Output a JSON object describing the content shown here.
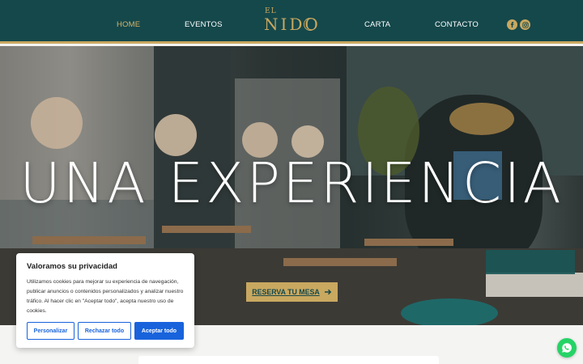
{
  "nav": {
    "items": [
      {
        "label": "HOME",
        "active": true
      },
      {
        "label": "EVENTOS",
        "active": false
      },
      {
        "label": "CARTA",
        "active": false
      },
      {
        "label": "CONTACTO",
        "active": false
      }
    ],
    "logo_top": "EL",
    "logo_main": "NIDO",
    "social": [
      "facebook-icon",
      "instagram-icon"
    ]
  },
  "hero": {
    "title": "UNA EXPERIENCIA",
    "cta_label": "RESERVA TU MESA"
  },
  "cookie": {
    "title": "Valoramos su privacidad",
    "text": "Utilizamos cookies para mejorar su experiencia de navegación, publicar anuncios o contenidos personalizados y analizar nuestro tráfico. Al hacer clic en \"Aceptar todo\", acepta nuestro uso de cookies.",
    "customize": "Personalizar",
    "reject": "Rechazar todo",
    "accept": "Aceptar todo"
  },
  "colors": {
    "nav_bg": "#15484b",
    "gold": "#c9a860",
    "cookie_blue": "#1863dc",
    "whatsapp": "#25d366"
  }
}
